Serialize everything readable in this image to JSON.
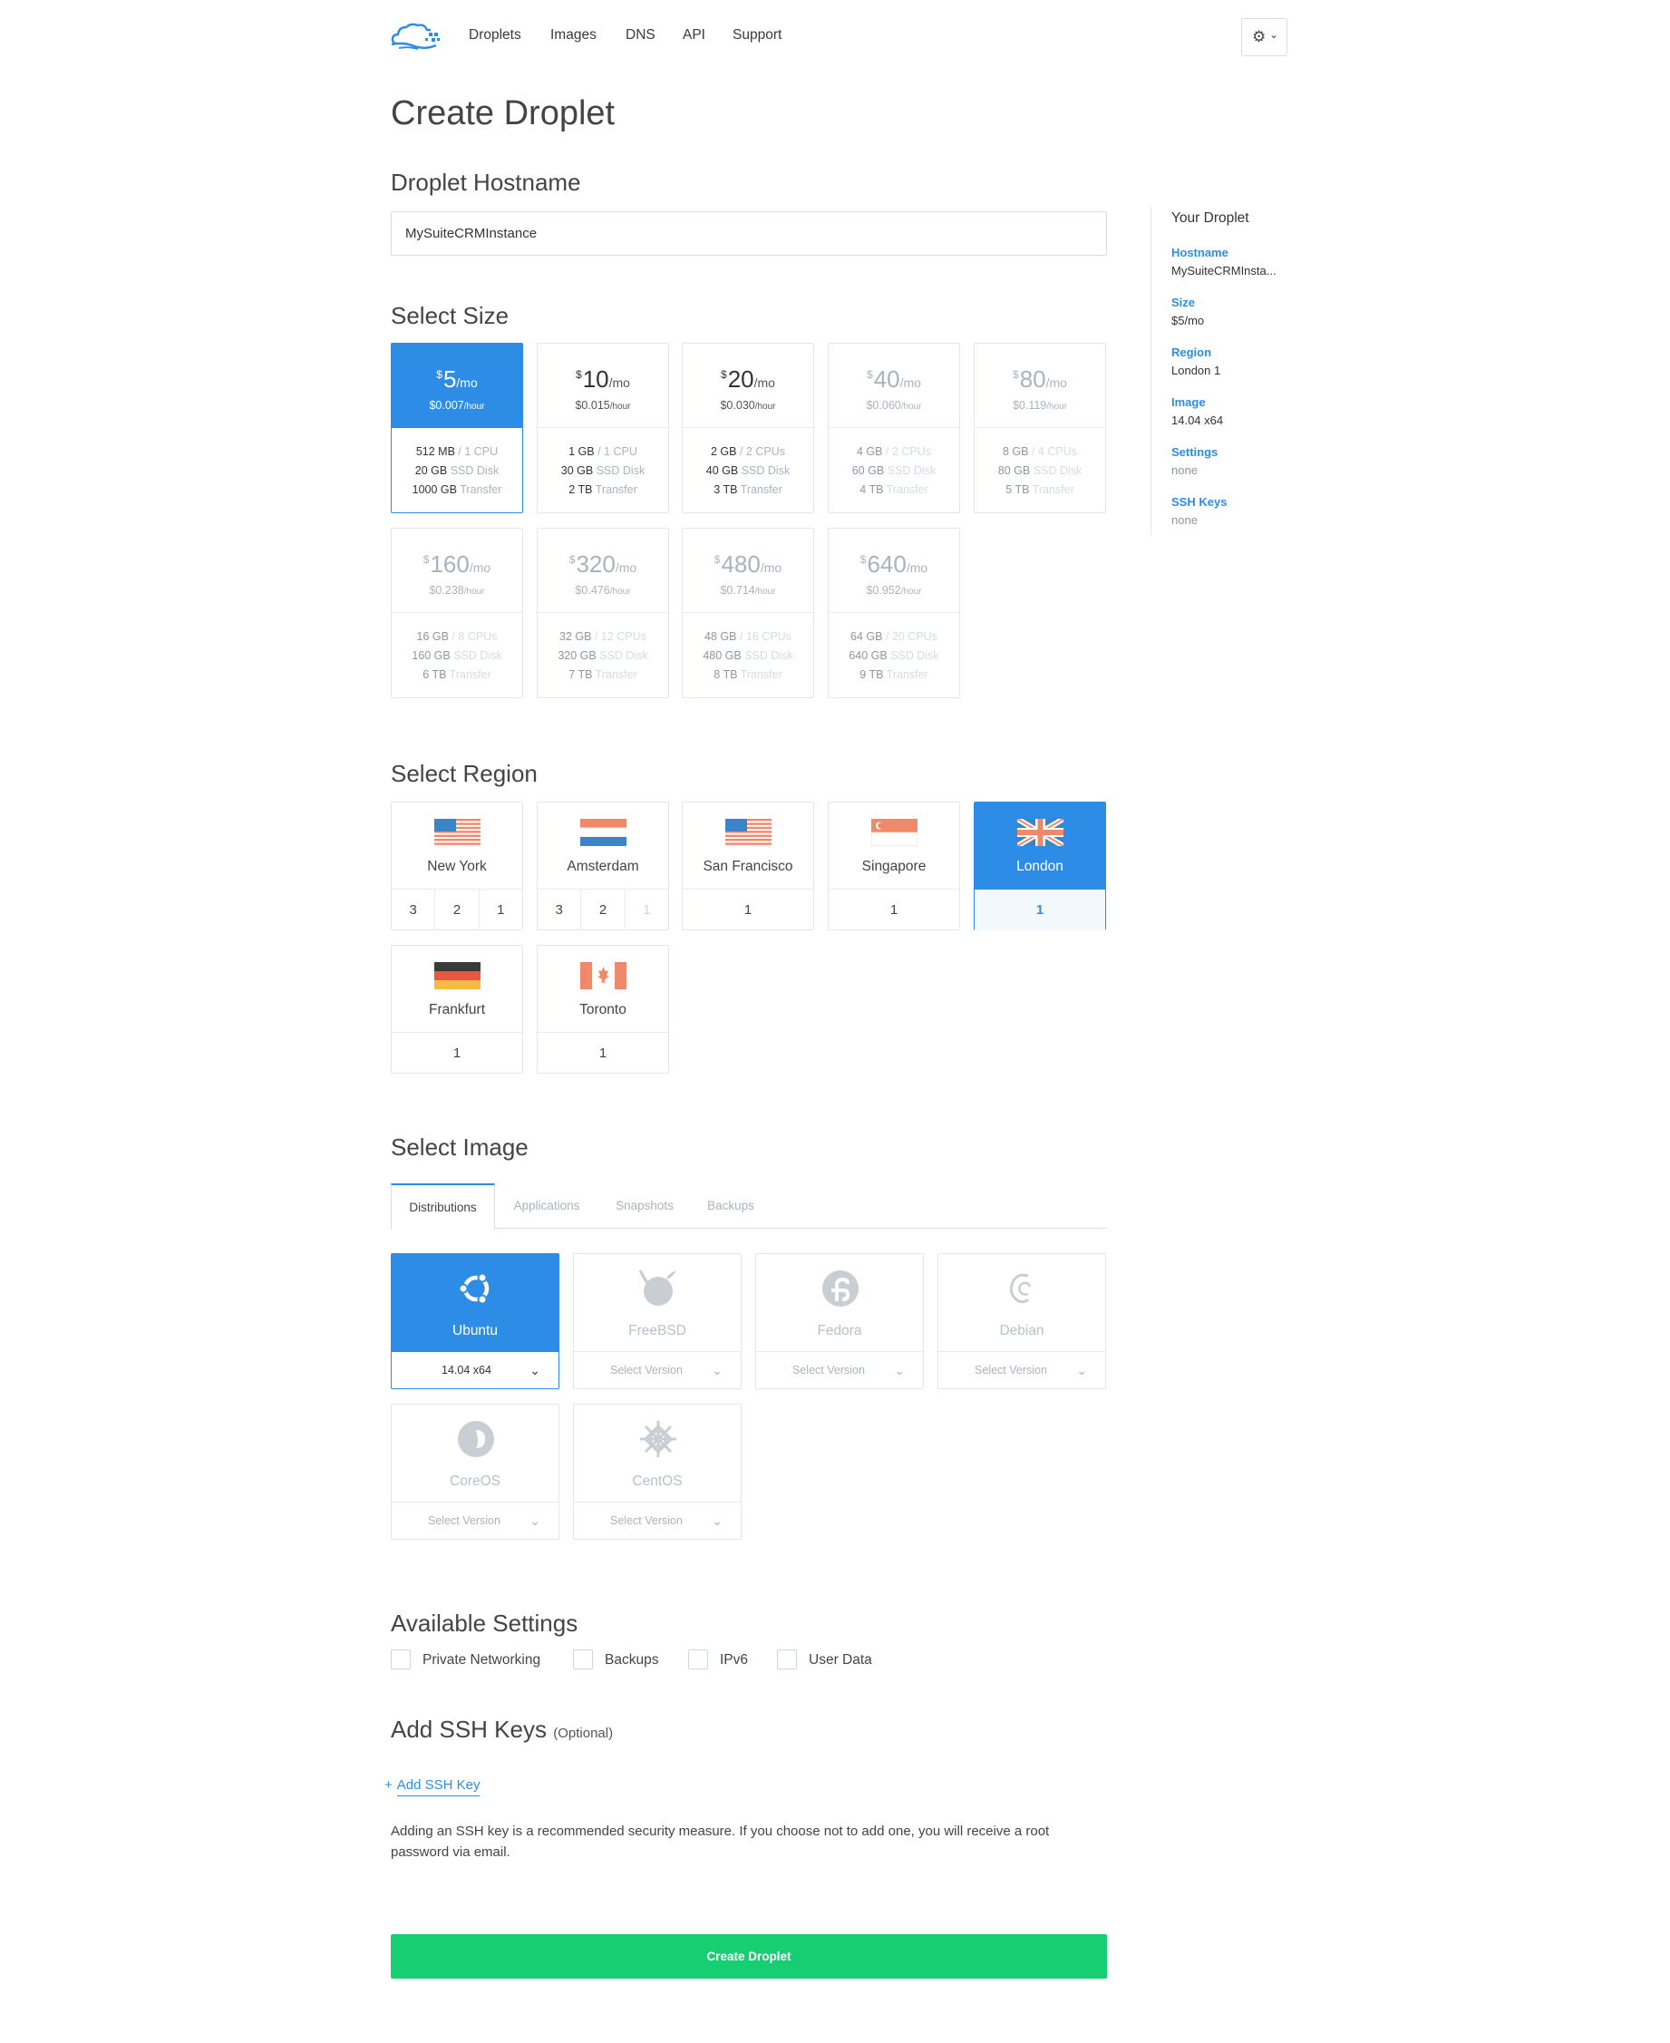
{
  "nav": {
    "links": [
      "Droplets",
      "Images",
      "DNS",
      "API",
      "Support"
    ],
    "settings_icon": "gear-icon",
    "settings_chevron": "⌄"
  },
  "page_title": "Create Droplet",
  "hostname": {
    "heading": "Droplet Hostname",
    "value": "MySuiteCRMInstance"
  },
  "size": {
    "heading": "Select Size",
    "plans": [
      {
        "price": "5",
        "per": "/mo",
        "hourly": "$0.007",
        "hour_unit": "/hour",
        "ram": "512 MB",
        "cpu": "/ 1 CPU",
        "disk": "20 GB",
        "disk_lbl": "SSD Disk",
        "transfer": "1000 GB",
        "transfer_lbl": "Transfer"
      },
      {
        "price": "10",
        "per": "/mo",
        "hourly": "$0.015",
        "hour_unit": "/hour",
        "ram": "1 GB",
        "cpu": "/ 1 CPU",
        "disk": "30 GB",
        "disk_lbl": "SSD Disk",
        "transfer": "2 TB",
        "transfer_lbl": "Transfer"
      },
      {
        "price": "20",
        "per": "/mo",
        "hourly": "$0.030",
        "hour_unit": "/hour",
        "ram": "2 GB",
        "cpu": "/ 2 CPUs",
        "disk": "40 GB",
        "disk_lbl": "SSD Disk",
        "transfer": "3 TB",
        "transfer_lbl": "Transfer"
      },
      {
        "price": "40",
        "per": "/mo",
        "hourly": "$0.060",
        "hour_unit": "/hour",
        "ram": "4 GB",
        "cpu": "/ 2 CPUs",
        "disk": "60 GB",
        "disk_lbl": "SSD Disk",
        "transfer": "4 TB",
        "transfer_lbl": "Transfer"
      },
      {
        "price": "80",
        "per": "/mo",
        "hourly": "$0.119",
        "hour_unit": "/hour",
        "ram": "8 GB",
        "cpu": "/ 4 CPUs",
        "disk": "80 GB",
        "disk_lbl": "SSD Disk",
        "transfer": "5 TB",
        "transfer_lbl": "Transfer"
      },
      {
        "price": "160",
        "per": "/mo",
        "hourly": "$0.238",
        "hour_unit": "/hour",
        "ram": "16 GB",
        "cpu": "/ 8 CPUs",
        "disk": "160 GB",
        "disk_lbl": "SSD Disk",
        "transfer": "6 TB",
        "transfer_lbl": "Transfer"
      },
      {
        "price": "320",
        "per": "/mo",
        "hourly": "$0.476",
        "hour_unit": "/hour",
        "ram": "32 GB",
        "cpu": "/ 12 CPUs",
        "disk": "320 GB",
        "disk_lbl": "SSD Disk",
        "transfer": "7 TB",
        "transfer_lbl": "Transfer"
      },
      {
        "price": "480",
        "per": "/mo",
        "hourly": "$0.714",
        "hour_unit": "/hour",
        "ram": "48 GB",
        "cpu": "/ 16 CPUs",
        "disk": "480 GB",
        "disk_lbl": "SSD Disk",
        "transfer": "8 TB",
        "transfer_lbl": "Transfer"
      },
      {
        "price": "640",
        "per": "/mo",
        "hourly": "$0.952",
        "hour_unit": "/hour",
        "ram": "64 GB",
        "cpu": "/ 20 CPUs",
        "disk": "640 GB",
        "disk_lbl": "SSD Disk",
        "transfer": "9 TB",
        "transfer_lbl": "Transfer"
      }
    ],
    "currency": "$"
  },
  "region": {
    "heading": "Select Region",
    "regions": [
      {
        "name": "New York",
        "nums": [
          "3",
          "2",
          "1"
        ]
      },
      {
        "name": "Amsterdam",
        "nums": [
          "3",
          "2",
          "1"
        ]
      },
      {
        "name": "San Francisco",
        "nums": [
          "1"
        ]
      },
      {
        "name": "Singapore",
        "nums": [
          "1"
        ]
      },
      {
        "name": "London",
        "nums": [
          "1"
        ]
      },
      {
        "name": "Frankfurt",
        "nums": [
          "1"
        ]
      },
      {
        "name": "Toronto",
        "nums": [
          "1"
        ]
      }
    ]
  },
  "image": {
    "heading": "Select Image",
    "tabs": [
      "Distributions",
      "Applications",
      "Snapshots",
      "Backups"
    ],
    "distros": [
      {
        "name": "Ubuntu",
        "version": "14.04 x64",
        "icon": "ubuntu-icon"
      },
      {
        "name": "FreeBSD",
        "version": "Select Version",
        "icon": "freebsd-icon"
      },
      {
        "name": "Fedora",
        "version": "Select Version",
        "icon": "fedora-icon"
      },
      {
        "name": "Debian",
        "version": "Select Version",
        "icon": "debian-icon"
      },
      {
        "name": "CoreOS",
        "version": "Select Version",
        "icon": "coreos-icon"
      },
      {
        "name": "CentOS",
        "version": "Select Version",
        "icon": "centos-icon"
      }
    ]
  },
  "settings": {
    "heading": "Available Settings",
    "options": [
      "Private Networking",
      "Backups",
      "IPv6",
      "User Data"
    ]
  },
  "ssh": {
    "heading": "Add SSH Keys",
    "optional": "(Optional)",
    "add_plus": "+",
    "add_label": "Add SSH Key",
    "note": "Adding an SSH key is a recommended security measure. If you choose not to add one, you will receive a root password via email."
  },
  "create_button": "Create Droplet",
  "sidebar": {
    "title": "Your Droplet",
    "items": [
      {
        "label": "Hostname",
        "value": "MySuiteCRMInsta..."
      },
      {
        "label": "Size",
        "value": "$5/mo"
      },
      {
        "label": "Region",
        "value": "London 1"
      },
      {
        "label": "Image",
        "value": "14.04 x64"
      },
      {
        "label": "Settings",
        "value": "none"
      },
      {
        "label": "SSH Keys",
        "value": "none"
      }
    ]
  },
  "colors": {
    "accent": "#2d8de6",
    "create": "#16cf73",
    "flag_red": "#ee8a6b",
    "flag_blue": "#3b84c8"
  }
}
